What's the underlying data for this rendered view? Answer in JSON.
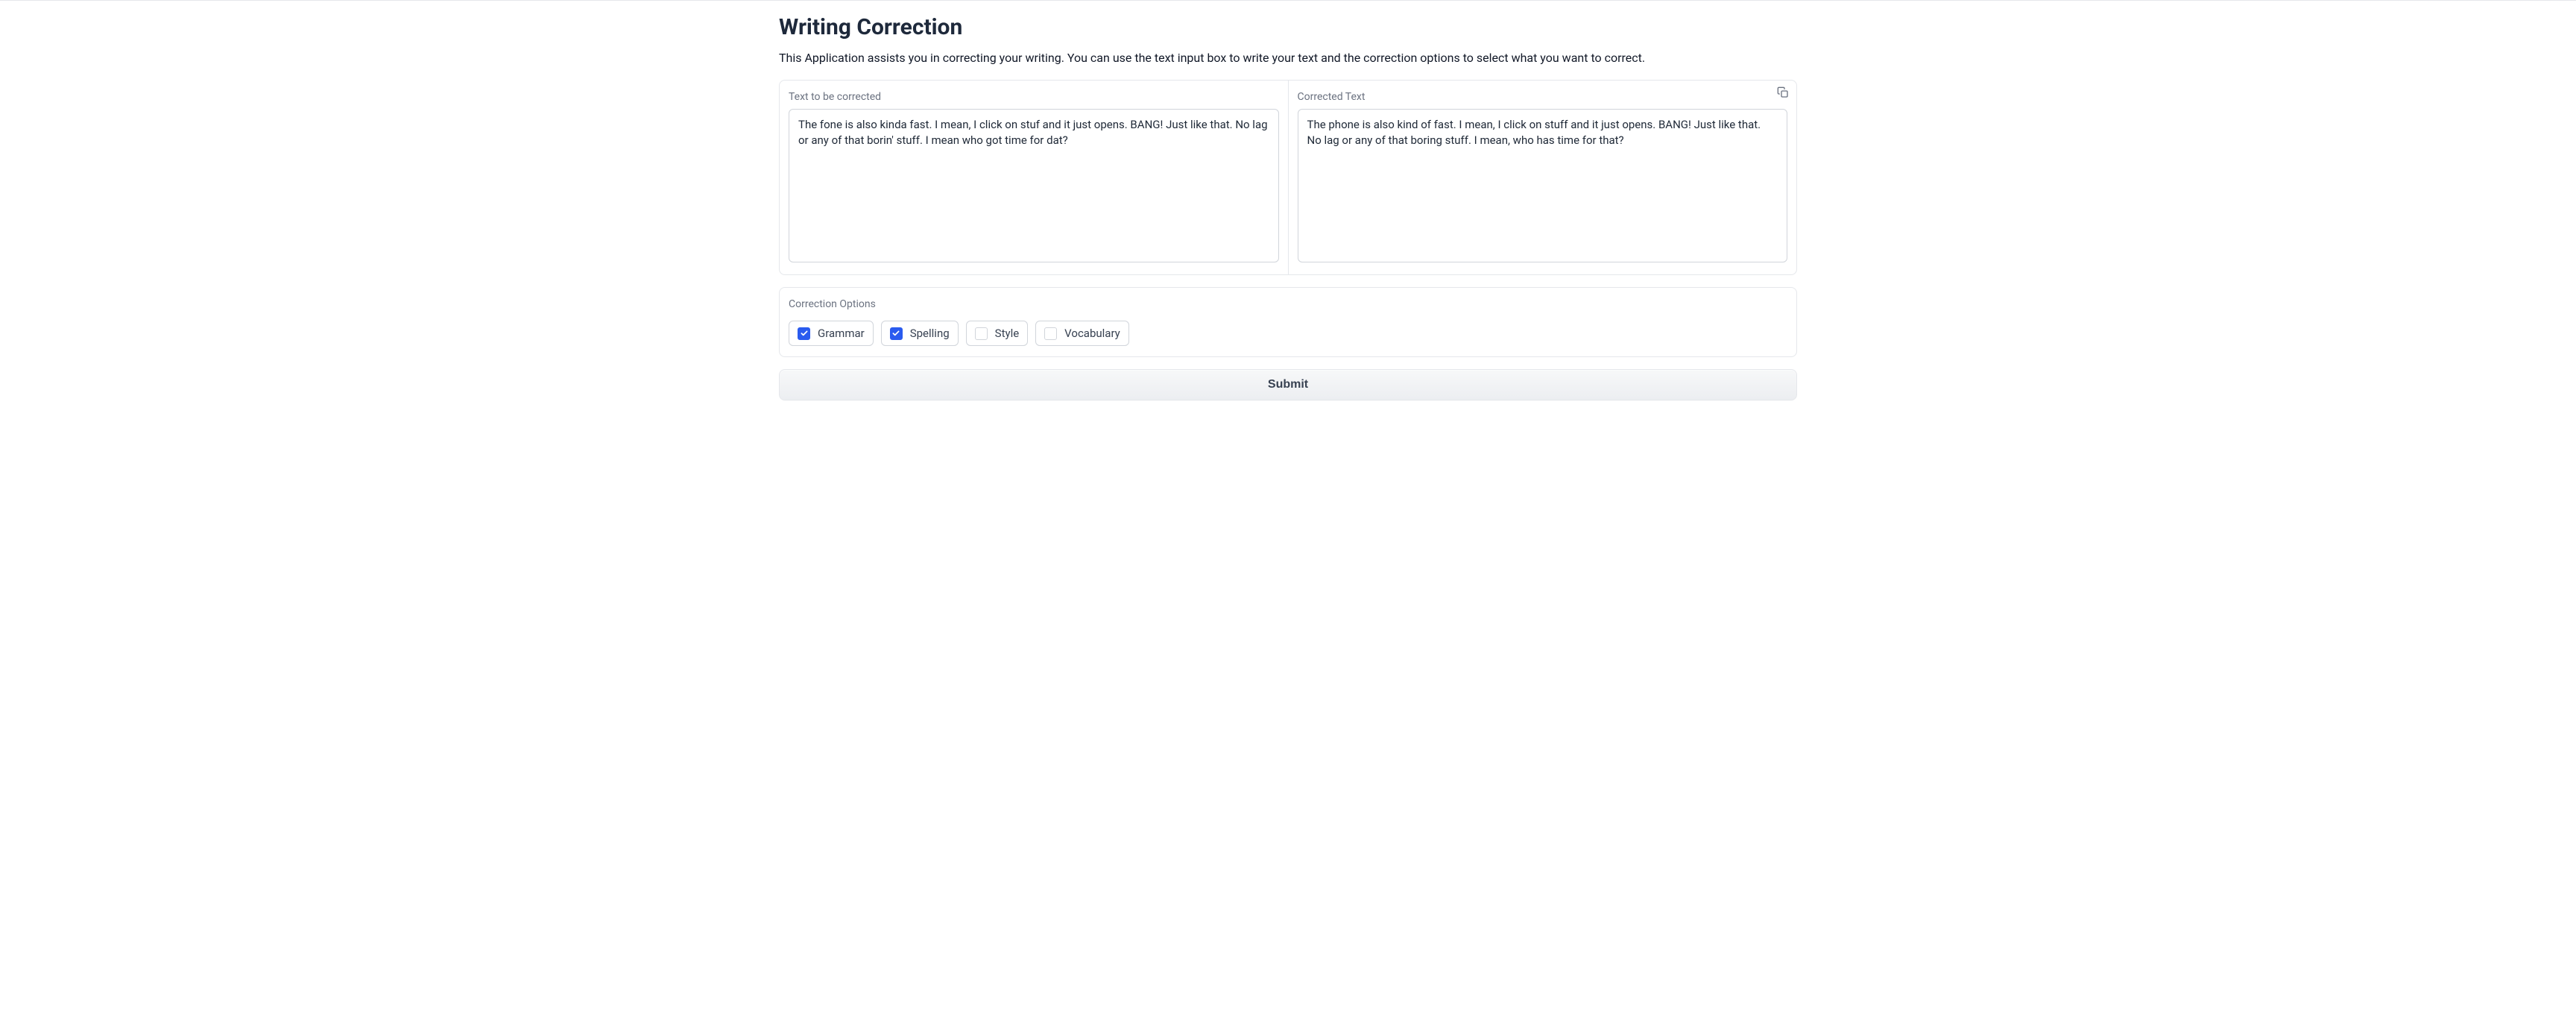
{
  "header": {
    "title": "Writing Correction",
    "description": "This Application assists you in correcting your writing. You can use the text input box to write your text and the correction options to select what you want to correct."
  },
  "input_panel": {
    "label": "Text to be corrected",
    "value": "The fone is also kinda fast. I mean, I click on stuf and it just opens. BANG! Just like that. No lag or any of that borin' stuff. I mean who got time for dat?"
  },
  "output_panel": {
    "label": "Corrected Text",
    "value": "The phone is also kind of fast. I mean, I click on stuff and it just opens. BANG! Just like that. No lag or any of that boring stuff. I mean, who has time for that?"
  },
  "options": {
    "label": "Correction Options",
    "items": [
      {
        "label": "Grammar",
        "checked": true
      },
      {
        "label": "Spelling",
        "checked": true
      },
      {
        "label": "Style",
        "checked": false
      },
      {
        "label": "Vocabulary",
        "checked": false
      }
    ]
  },
  "submit": {
    "label": "Submit"
  }
}
